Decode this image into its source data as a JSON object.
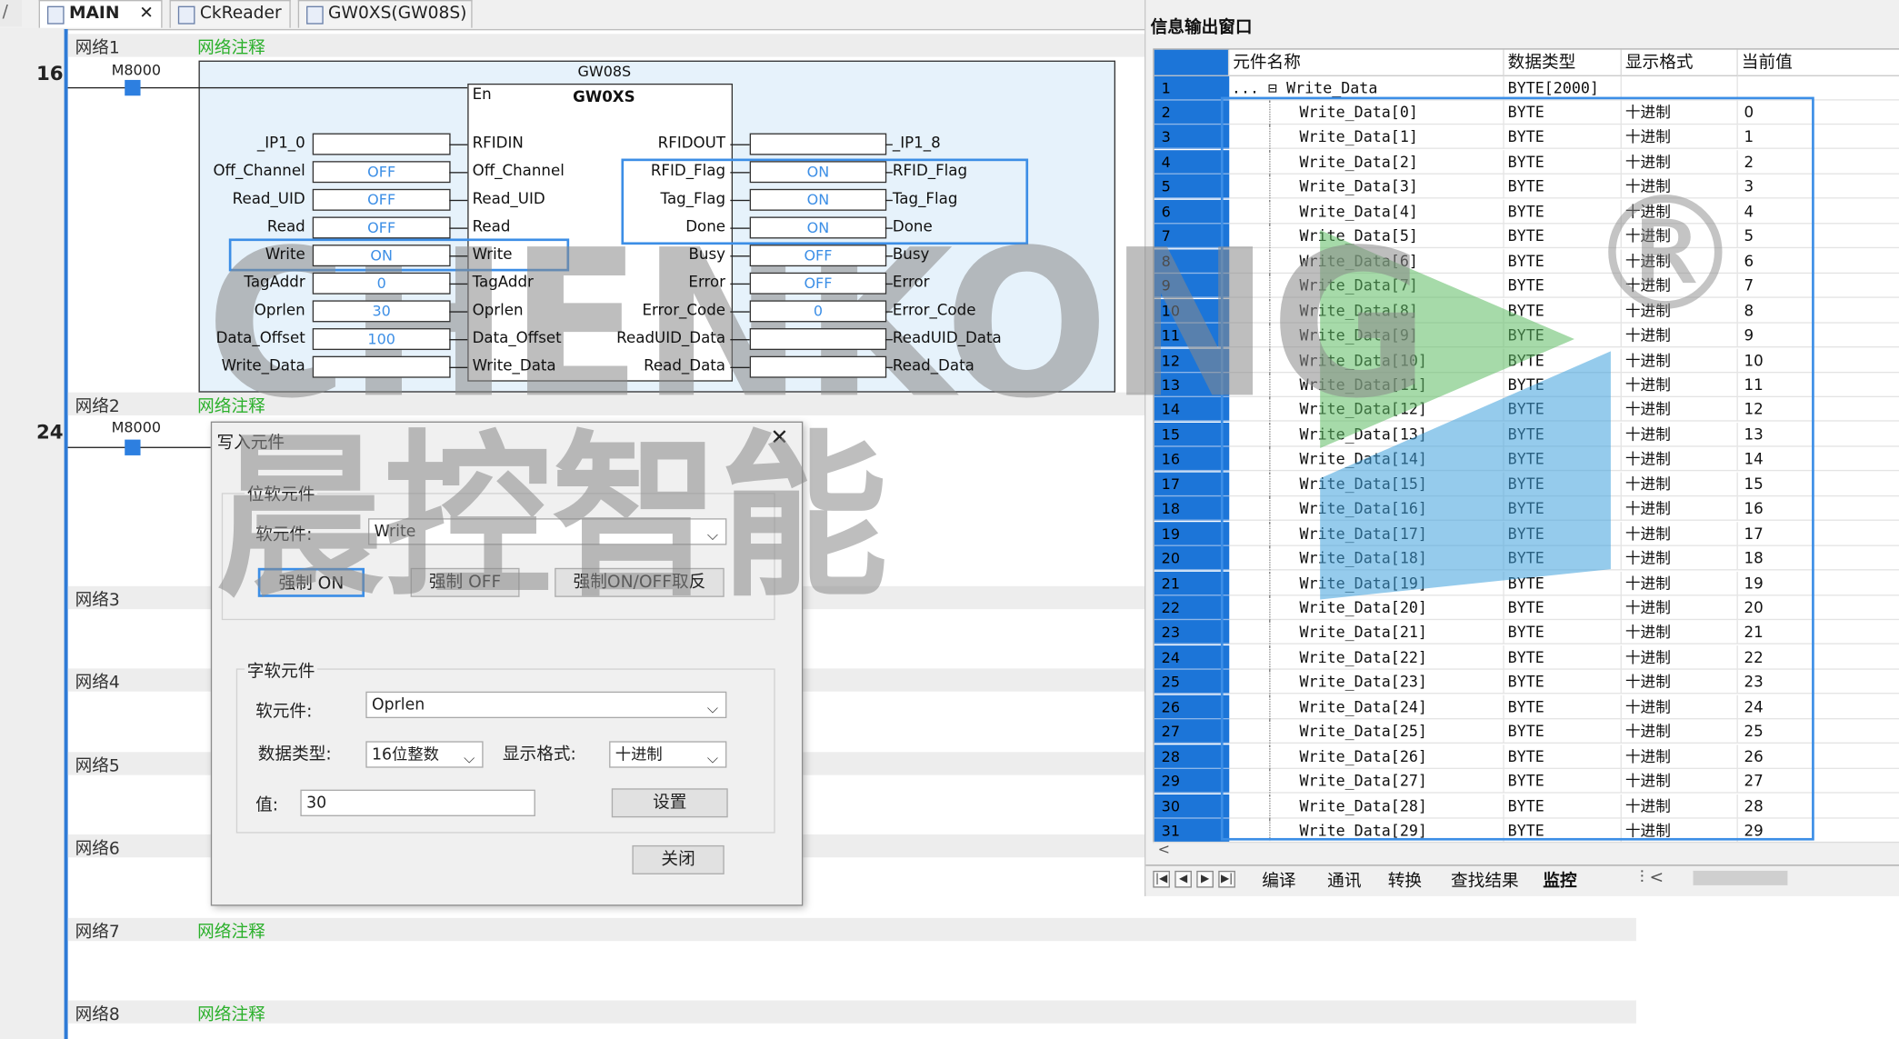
{
  "tabs": [
    {
      "label": "MAIN",
      "active": true
    },
    {
      "label": "CkReader"
    },
    {
      "label": "GW0XS(GW08S)"
    }
  ],
  "editor": {
    "networks": [
      {
        "name": "网络1",
        "comment": "网络注释",
        "line": "16"
      },
      {
        "name": "网络2",
        "comment": "网络注释",
        "line": "24"
      },
      {
        "name": "网络3",
        "comment": ""
      },
      {
        "name": "网络4",
        "comment": ""
      },
      {
        "name": "网络5",
        "comment": ""
      },
      {
        "name": "网络6",
        "comment": ""
      },
      {
        "name": "网络7",
        "comment": "网络注释"
      },
      {
        "name": "网络8",
        "comment": "网络注释"
      }
    ],
    "contact_label": "M8000",
    "fb_instance": "GW08S",
    "fb_type": "GW0XS",
    "en_label": "En",
    "inputs": [
      {
        "ext": "_IP1_0",
        "value": "",
        "pin": "RFIDIN"
      },
      {
        "ext": "Off_Channel",
        "value": "OFF",
        "pin": "Off_Channel"
      },
      {
        "ext": "Read_UID",
        "value": "OFF",
        "pin": "Read_UID"
      },
      {
        "ext": "Read",
        "value": "OFF",
        "pin": "Read"
      },
      {
        "ext": "Write",
        "value": "ON",
        "pin": "Write"
      },
      {
        "ext": "TagAddr",
        "value": "0",
        "pin": "TagAddr"
      },
      {
        "ext": "Oprlen",
        "value": "30",
        "pin": "Oprlen"
      },
      {
        "ext": "Data_Offset",
        "value": "100",
        "pin": "Data_Offset"
      },
      {
        "ext": "Write_Data",
        "value": "",
        "pin": "Write_Data"
      }
    ],
    "outputs": [
      {
        "pin": "RFIDOUT",
        "value": "",
        "ext": "_IP1_8"
      },
      {
        "pin": "RFID_Flag",
        "value": "ON",
        "ext": "RFID_Flag"
      },
      {
        "pin": "Tag_Flag",
        "value": "ON",
        "ext": "Tag_Flag"
      },
      {
        "pin": "Done",
        "value": "ON",
        "ext": "Done"
      },
      {
        "pin": "Busy",
        "value": "OFF",
        "ext": "Busy"
      },
      {
        "pin": "Error",
        "value": "OFF",
        "ext": "Error"
      },
      {
        "pin": "Error_Code",
        "value": "0",
        "ext": "Error_Code"
      },
      {
        "pin": "ReadUID_Data",
        "value": "",
        "ext": "ReadUID_Data"
      },
      {
        "pin": "Read_Data",
        "value": "",
        "ext": "Read_Data"
      }
    ]
  },
  "dialog": {
    "title": "写入元件",
    "bit_group": "位软元件",
    "bit_device_label": "软元件:",
    "bit_device_value": "Write",
    "force_on": "强制 ON",
    "force_off": "强制 OFF",
    "force_toggle": "强制ON/OFF取反",
    "word_group": "字软元件",
    "word_device_label": "软元件:",
    "word_device_value": "Oprlen",
    "data_type_label": "数据类型:",
    "data_type_value": "16位整数",
    "display_format_label": "显示格式:",
    "display_format_value": "十进制",
    "value_label": "值:",
    "value": "30",
    "set_button": "设置",
    "close_button": "关闭"
  },
  "monitor": {
    "title": "信息输出窗口",
    "columns": [
      "元件名称",
      "数据类型",
      "显示格式",
      "当前值"
    ],
    "parent": {
      "row": "1",
      "prefix": "... ⊟",
      "name": "Write_Data",
      "type": "BYTE[2000]",
      "format": "",
      "value": ""
    },
    "rows": [
      {
        "row": "2",
        "name": "Write_Data[0]",
        "type": "BYTE",
        "format": "十进制",
        "value": "0"
      },
      {
        "row": "3",
        "name": "Write_Data[1]",
        "type": "BYTE",
        "format": "十进制",
        "value": "1"
      },
      {
        "row": "4",
        "name": "Write_Data[2]",
        "type": "BYTE",
        "format": "十进制",
        "value": "2"
      },
      {
        "row": "5",
        "name": "Write_Data[3]",
        "type": "BYTE",
        "format": "十进制",
        "value": "3"
      },
      {
        "row": "6",
        "name": "Write_Data[4]",
        "type": "BYTE",
        "format": "十进制",
        "value": "4"
      },
      {
        "row": "7",
        "name": "Write_Data[5]",
        "type": "BYTE",
        "format": "十进制",
        "value": "5"
      },
      {
        "row": "8",
        "name": "Write_Data[6]",
        "type": "BYTE",
        "format": "十进制",
        "value": "6"
      },
      {
        "row": "9",
        "name": "Write_Data[7]",
        "type": "BYTE",
        "format": "十进制",
        "value": "7"
      },
      {
        "row": "10",
        "name": "Write_Data[8]",
        "type": "BYTE",
        "format": "十进制",
        "value": "8"
      },
      {
        "row": "11",
        "name": "Write_Data[9]",
        "type": "BYTE",
        "format": "十进制",
        "value": "9"
      },
      {
        "row": "12",
        "name": "Write_Data[10]",
        "type": "BYTE",
        "format": "十进制",
        "value": "10"
      },
      {
        "row": "13",
        "name": "Write_Data[11]",
        "type": "BYTE",
        "format": "十进制",
        "value": "11"
      },
      {
        "row": "14",
        "name": "Write_Data[12]",
        "type": "BYTE",
        "format": "十进制",
        "value": "12"
      },
      {
        "row": "15",
        "name": "Write_Data[13]",
        "type": "BYTE",
        "format": "十进制",
        "value": "13"
      },
      {
        "row": "16",
        "name": "Write_Data[14]",
        "type": "BYTE",
        "format": "十进制",
        "value": "14"
      },
      {
        "row": "17",
        "name": "Write_Data[15]",
        "type": "BYTE",
        "format": "十进制",
        "value": "15"
      },
      {
        "row": "18",
        "name": "Write_Data[16]",
        "type": "BYTE",
        "format": "十进制",
        "value": "16"
      },
      {
        "row": "19",
        "name": "Write_Data[17]",
        "type": "BYTE",
        "format": "十进制",
        "value": "17"
      },
      {
        "row": "20",
        "name": "Write_Data[18]",
        "type": "BYTE",
        "format": "十进制",
        "value": "18"
      },
      {
        "row": "21",
        "name": "Write_Data[19]",
        "type": "BYTE",
        "format": "十进制",
        "value": "19"
      },
      {
        "row": "22",
        "name": "Write_Data[20]",
        "type": "BYTE",
        "format": "十进制",
        "value": "20"
      },
      {
        "row": "23",
        "name": "Write_Data[21]",
        "type": "BYTE",
        "format": "十进制",
        "value": "21"
      },
      {
        "row": "24",
        "name": "Write_Data[22]",
        "type": "BYTE",
        "format": "十进制",
        "value": "22"
      },
      {
        "row": "25",
        "name": "Write_Data[23]",
        "type": "BYTE",
        "format": "十进制",
        "value": "23"
      },
      {
        "row": "26",
        "name": "Write_Data[24]",
        "type": "BYTE",
        "format": "十进制",
        "value": "24"
      },
      {
        "row": "27",
        "name": "Write_Data[25]",
        "type": "BYTE",
        "format": "十进制",
        "value": "25"
      },
      {
        "row": "28",
        "name": "Write_Data[26]",
        "type": "BYTE",
        "format": "十进制",
        "value": "26"
      },
      {
        "row": "29",
        "name": "Write_Data[27]",
        "type": "BYTE",
        "format": "十进制",
        "value": "27"
      },
      {
        "row": "30",
        "name": "Write_Data[28]",
        "type": "BYTE",
        "format": "十进制",
        "value": "28"
      },
      {
        "row": "31",
        "name": "Write_Data[29]",
        "type": "BYTE",
        "format": "十进制",
        "value": "29"
      }
    ],
    "bottom_tabs": [
      "编译",
      "通讯",
      "转换",
      "查找结果",
      "监控"
    ]
  },
  "watermark": {
    "latin": "CHENKONG",
    "chinese": "晨控智能",
    "mark": "®"
  },
  "colors": {
    "selection_blue": "#3c8ee6",
    "row_header_blue": "#1c75d8",
    "comment_green": "#2bb02b",
    "watermark_gray": "#8a8a8a",
    "accent_green": "#5dbb63",
    "accent_blue": "#3ea0dc"
  }
}
